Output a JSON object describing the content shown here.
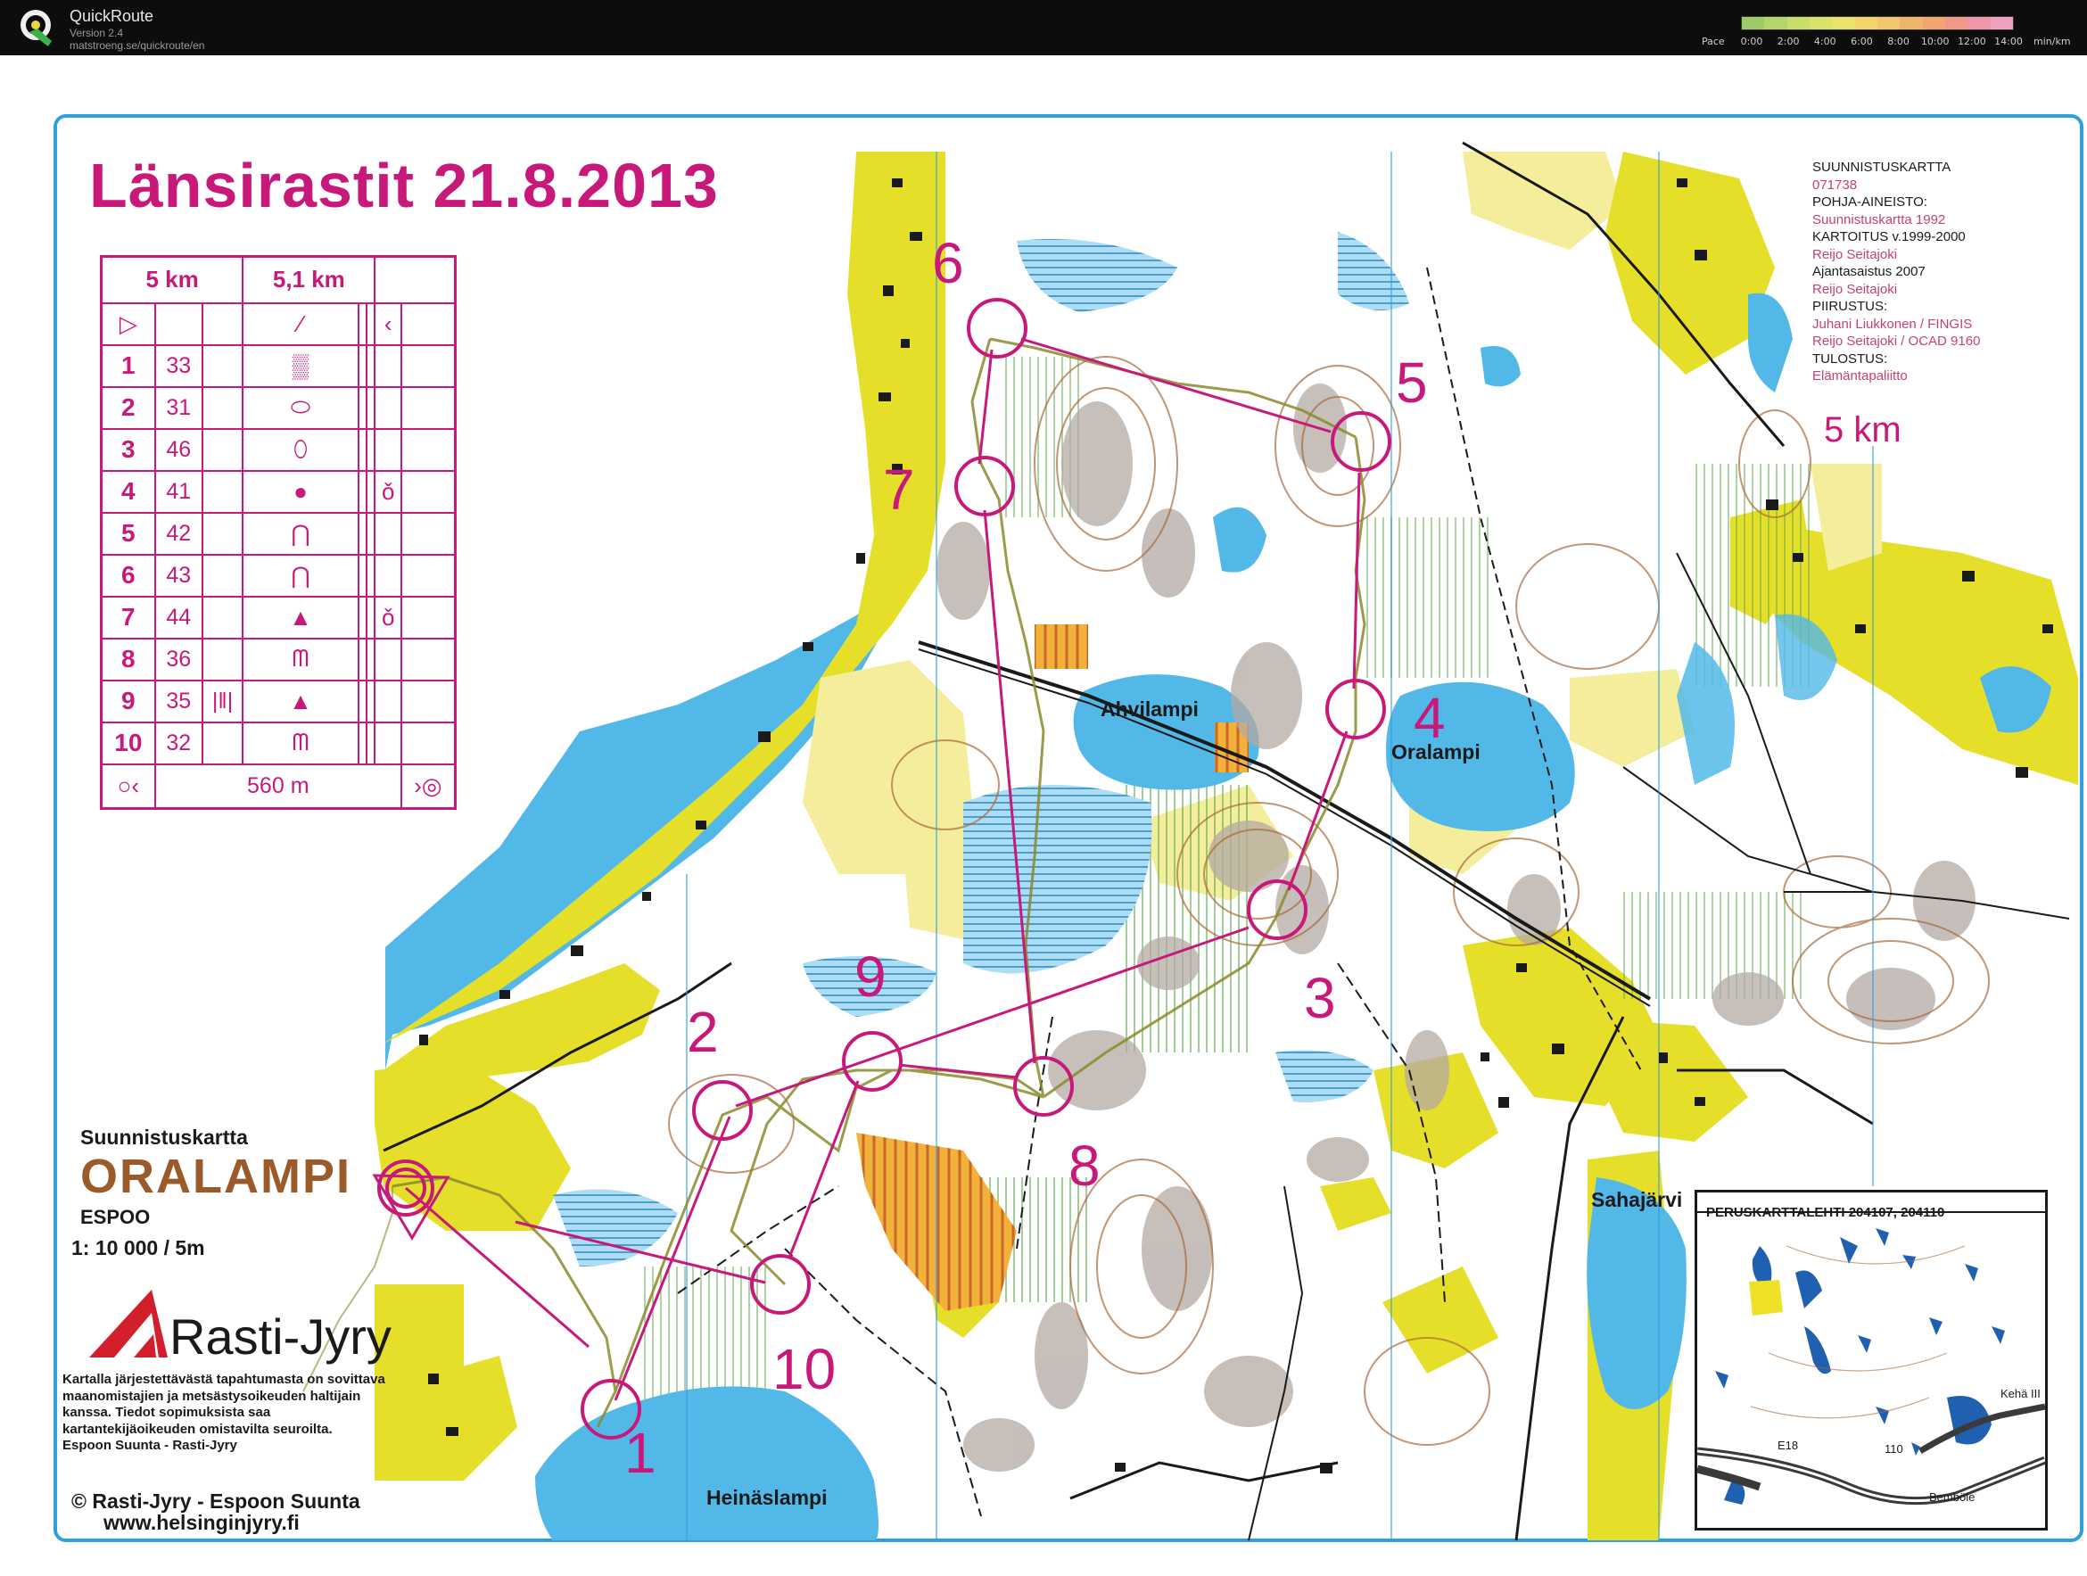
{
  "app": {
    "name": "QuickRoute",
    "version": "Version 2.4",
    "url": "matstroeng.se/quickroute/en",
    "pace_label": "Pace",
    "pace_ticks": [
      "0:00",
      "2:00",
      "4:00",
      "6:00",
      "8:00",
      "10:00",
      "12:00",
      "14:00"
    ],
    "pace_unit": "min/km",
    "pace_colors": [
      "#9ecb6a",
      "#b2d66b",
      "#c7de6b",
      "#d9e36b",
      "#e9e26d",
      "#f1d56c",
      "#f3c56d",
      "#f1b46e",
      "#f0a573",
      "#ef9a86",
      "#ef96a8",
      "#eea0bf"
    ]
  },
  "map": {
    "event_title": "Länsirastit 21.8.2013",
    "course_length": "5 km",
    "map_type": "Suunnistuskartta",
    "map_name": "ORALAMPI",
    "city": "ESPOO",
    "scale": "1: 10 000 /  5m",
    "club": "Rasti-Jyry",
    "notice": "Kartalla järjestettävästä tapahtumasta on sovittava maanomistajien ja metsästysoikeuden haltijain kanssa. Tiedot sopimuksista saa kartantekijäoikeuden omistavilta seuroilta.",
    "notice_line2": "Espoon Suunta  -  Rasti-Jyry",
    "copyright": "© Rasti-Jyry - Espoon Suunta",
    "website": "www.helsinginjyry.fi",
    "lakes": [
      "Ahvilampi",
      "Oralampi",
      "Sahajärvi",
      "Heinäslampi"
    ],
    "controls": [
      {
        "label": "1"
      },
      {
        "label": "2"
      },
      {
        "label": "3"
      },
      {
        "label": "4"
      },
      {
        "label": "5"
      },
      {
        "label": "6"
      },
      {
        "label": "7"
      },
      {
        "label": "8"
      },
      {
        "label": "9"
      },
      {
        "label": "10"
      }
    ],
    "colors": {
      "course": "#c8187a",
      "water": "#52b8e8",
      "open_yellow": "#e6df2a",
      "field_pale": "#f4ee9c",
      "route": "#8a8a2a",
      "contour": "#a86a3a",
      "rock": "#b3a9a3"
    }
  },
  "description_sheet": {
    "header": [
      "5 km",
      "5,1 km"
    ],
    "controls": [
      {
        "n": "1",
        "code": "33"
      },
      {
        "n": "2",
        "code": "31"
      },
      {
        "n": "3",
        "code": "46"
      },
      {
        "n": "4",
        "code": "41"
      },
      {
        "n": "5",
        "code": "42"
      },
      {
        "n": "6",
        "code": "43"
      },
      {
        "n": "7",
        "code": "44"
      },
      {
        "n": "8",
        "code": "36"
      },
      {
        "n": "9",
        "code": "35"
      },
      {
        "n": "10",
        "code": "32"
      }
    ],
    "finish_distance": "560 m"
  },
  "credits": {
    "title": "SUUNNISTUSKARTTA",
    "number": "071738",
    "base_label": "POHJA-AINEISTO:",
    "base_value": "Suunnistuskartta 1992",
    "survey_label": "KARTOITUS v.1999-2000",
    "survey_value": "Reijo Seitajoki",
    "update_label": "Ajantasaistus 2007",
    "update_value": "Reijo Seitajoki",
    "drawing_label": "PIIRUSTUS:",
    "drawing_value1": "Juhani Liukkonen / FINGIS",
    "drawing_value2": "Reijo Seitajoki / OCAD 9160",
    "print_label": "TULOSTUS:",
    "print_value": "Elämäntapaliitto"
  },
  "inset": {
    "title": "PERUSKARTTALEHTI  204107, 204110",
    "labels": [
      "Kehä III",
      "E18",
      "110",
      "Bemböle"
    ]
  }
}
